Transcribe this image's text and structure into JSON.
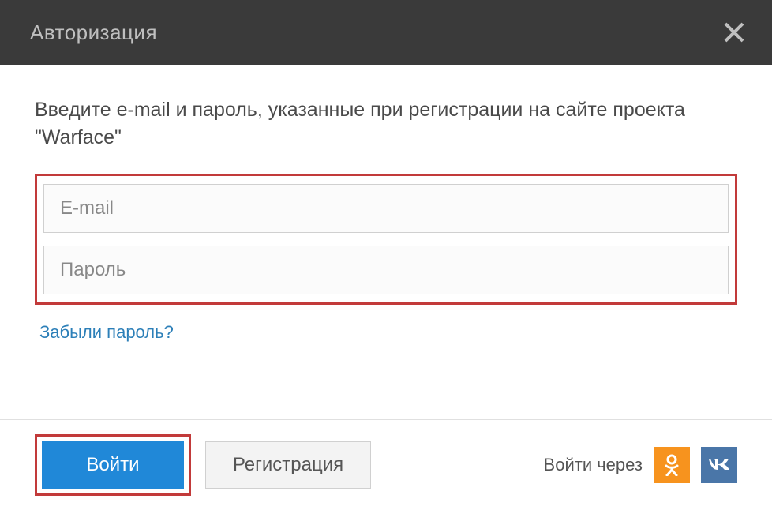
{
  "titlebar": {
    "title": "Авторизация"
  },
  "content": {
    "instruction": "Введите e-mail и пароль, указанные при регистрации на сайте проекта \"Warface\"",
    "email_placeholder": "E-mail",
    "password_placeholder": "Пароль",
    "forgot_link": "Забыли пароль?"
  },
  "footer": {
    "login_label": "Войти",
    "register_label": "Регистрация",
    "social_label": "Войти через"
  }
}
